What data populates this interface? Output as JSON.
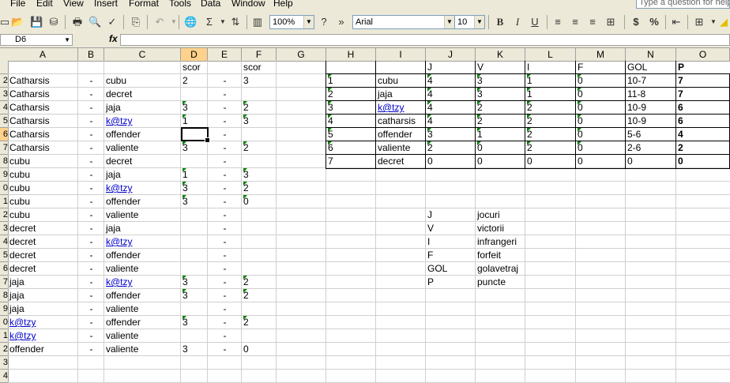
{
  "menu": {
    "items": [
      "File",
      "Edit",
      "View",
      "Insert",
      "Format",
      "Tools",
      "Data",
      "Window",
      "Help"
    ],
    "help_placeholder": "Type a question for help"
  },
  "toolbar": {
    "zoom": "100%",
    "font": "Arial",
    "font_size": "10"
  },
  "formula_bar": {
    "name_box": "D6",
    "fx": "fx",
    "formula": ""
  },
  "columns": [
    "A",
    "B",
    "C",
    "D",
    "E",
    "F",
    "G",
    "H",
    "I",
    "J",
    "K",
    "L",
    "M",
    "N",
    "O"
  ],
  "selected_column": "D",
  "rows": [
    "",
    "2",
    "3",
    "4",
    "5",
    "6",
    "7",
    "8",
    "9",
    "0",
    "1",
    "2",
    "3",
    "4",
    "5",
    "6",
    "7",
    "8",
    "9",
    "0",
    "1",
    "2",
    "3",
    "4"
  ],
  "selected_row": 5,
  "matches": {
    "header": {
      "d": "scor",
      "f": "scor"
    },
    "rows": [
      {
        "a": "Catharsis",
        "b": "-",
        "c": "cubu",
        "d": "2",
        "e": "-",
        "f": "3"
      },
      {
        "a": "Catharsis",
        "b": "-",
        "c": "decret",
        "d": "",
        "e": "-",
        "f": ""
      },
      {
        "a": "Catharsis",
        "b": "-",
        "c": "jaja",
        "d": "3",
        "e": "-",
        "f": "2"
      },
      {
        "a": "Catharsis",
        "b": "-",
        "c": "k@tzy",
        "d": "1",
        "e": "-",
        "f": "3"
      },
      {
        "a": "Catharsis",
        "b": "-",
        "c": "offender",
        "d": "",
        "e": "-",
        "f": ""
      },
      {
        "a": "Catharsis",
        "b": "-",
        "c": "valiente",
        "d": "3",
        "e": "-",
        "f": "2"
      },
      {
        "a": "cubu",
        "b": "-",
        "c": "decret",
        "d": "",
        "e": "-",
        "f": ""
      },
      {
        "a": "cubu",
        "b": "-",
        "c": "jaja",
        "d": "1",
        "e": "-",
        "f": "3"
      },
      {
        "a": "cubu",
        "b": "-",
        "c": "k@tzy",
        "d": "3",
        "e": "-",
        "f": "2"
      },
      {
        "a": "cubu",
        "b": "-",
        "c": "offender",
        "d": "3",
        "e": "-",
        "f": "0"
      },
      {
        "a": "cubu",
        "b": "-",
        "c": "valiente",
        "d": "",
        "e": "-",
        "f": ""
      },
      {
        "a": "decret",
        "b": "-",
        "c": "jaja",
        "d": "",
        "e": "-",
        "f": ""
      },
      {
        "a": "decret",
        "b": "-",
        "c": "k@tzy",
        "d": "",
        "e": "-",
        "f": ""
      },
      {
        "a": "decret",
        "b": "-",
        "c": "offender",
        "d": "",
        "e": "-",
        "f": ""
      },
      {
        "a": "decret",
        "b": "-",
        "c": "valiente",
        "d": "",
        "e": "-",
        "f": ""
      },
      {
        "a": "jaja",
        "b": "-",
        "c": "k@tzy",
        "d": "3",
        "e": "-",
        "f": "2"
      },
      {
        "a": "jaja",
        "b": "-",
        "c": "offender",
        "d": "3",
        "e": "-",
        "f": "2"
      },
      {
        "a": "jaja",
        "b": "-",
        "c": "valiente",
        "d": "",
        "e": "-",
        "f": ""
      },
      {
        "a": "k@tzy",
        "b": "-",
        "c": "offender",
        "d": "3",
        "e": "-",
        "f": "2"
      },
      {
        "a": "k@tzy",
        "b": "-",
        "c": "valiente",
        "d": "",
        "e": "-",
        "f": ""
      },
      {
        "a": "offender",
        "b": "-",
        "c": "valiente",
        "d": "3",
        "e": "-",
        "f": "0"
      }
    ]
  },
  "standings": {
    "headers": [
      "",
      "",
      "J",
      "V",
      "I",
      "F",
      "GOL",
      "P"
    ],
    "rows": [
      [
        "1",
        "cubu",
        "4",
        "3",
        "1",
        "0",
        "10-7",
        "7"
      ],
      [
        "2",
        "jaja",
        "4",
        "3",
        "1",
        "0",
        "11-8",
        "7"
      ],
      [
        "3",
        "k@tzy",
        "4",
        "2",
        "2",
        "0",
        "10-9",
        "6"
      ],
      [
        "4",
        "catharsis",
        "4",
        "2",
        "2",
        "0",
        "10-9",
        "6"
      ],
      [
        "5",
        "offender",
        "3",
        "1",
        "2",
        "0",
        "5-6",
        "4"
      ],
      [
        "6",
        "valiente",
        "2",
        "0",
        "2",
        "0",
        "2-6",
        "2"
      ],
      [
        "7",
        "decret",
        "0",
        "0",
        "0",
        "0",
        "0",
        "0"
      ]
    ]
  },
  "legend": [
    {
      "abbr": "J",
      "meaning": "jocuri"
    },
    {
      "abbr": "V",
      "meaning": "victorii"
    },
    {
      "abbr": "I",
      "meaning": "infrangeri"
    },
    {
      "abbr": "F",
      "meaning": "forfeit"
    },
    {
      "abbr": "GOL",
      "meaning": "golavetraj"
    },
    {
      "abbr": "P",
      "meaning": "puncte"
    }
  ]
}
